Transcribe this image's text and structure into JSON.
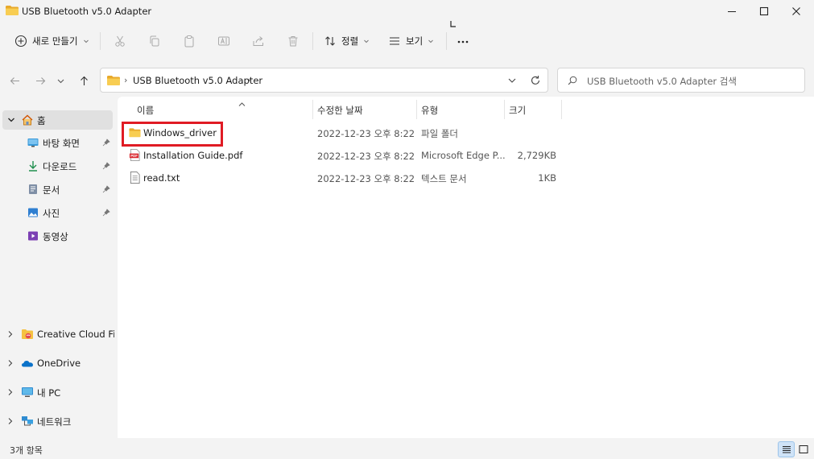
{
  "window": {
    "title": "USB Bluetooth v5.0 Adapter"
  },
  "toolbar": {
    "new_label": "새로 만들기",
    "sort_label": "정렬",
    "view_label": "보기",
    "more_label": "⋯"
  },
  "address": {
    "crumbs": [
      "USB Bluetooth v5.0 Adapter"
    ],
    "search_placeholder": "USB Bluetooth v5.0 Adapter 검색"
  },
  "nav": {
    "home_label": "홈",
    "quick_access": [
      {
        "label": "바탕 화면",
        "icon": "desktop-icon",
        "pinned": true
      },
      {
        "label": "다운로드",
        "icon": "download-icon",
        "pinned": true
      },
      {
        "label": "문서",
        "icon": "document-icon",
        "pinned": true
      },
      {
        "label": "사진",
        "icon": "picture-icon",
        "pinned": true
      },
      {
        "label": "동영상",
        "icon": "video-icon",
        "pinned": false
      }
    ],
    "roots": [
      {
        "label": "Creative Cloud Files",
        "icon": "creative-cloud-icon"
      },
      {
        "label": "OneDrive",
        "icon": "onedrive-icon"
      },
      {
        "label": "내 PC",
        "icon": "pc-icon"
      },
      {
        "label": "네트워크",
        "icon": "network-icon"
      }
    ]
  },
  "filelist": {
    "columns": {
      "name": "이름",
      "date": "수정한 날짜",
      "type": "유형",
      "size": "크기"
    },
    "rows": [
      {
        "name": "Windows_driver",
        "date": "2022-12-23 오후 8:22",
        "type": "파일 폴더",
        "size": "",
        "icon": "folder-icon"
      },
      {
        "name": "Installation Guide.pdf",
        "date": "2022-12-23 오후 8:22",
        "type": "Microsoft Edge P...",
        "size": "2,729KB",
        "icon": "pdf-icon"
      },
      {
        "name": "read.txt",
        "date": "2022-12-23 오후 8:22",
        "type": "텍스트 문서",
        "size": "1KB",
        "icon": "text-file-icon"
      }
    ]
  },
  "status": {
    "item_count": "3개 항목"
  },
  "colors": {
    "accent": "#0067c0",
    "highlight_box": "#e01b24",
    "folder_yellow": "#f5c242",
    "selection": "#e0e0e0"
  }
}
